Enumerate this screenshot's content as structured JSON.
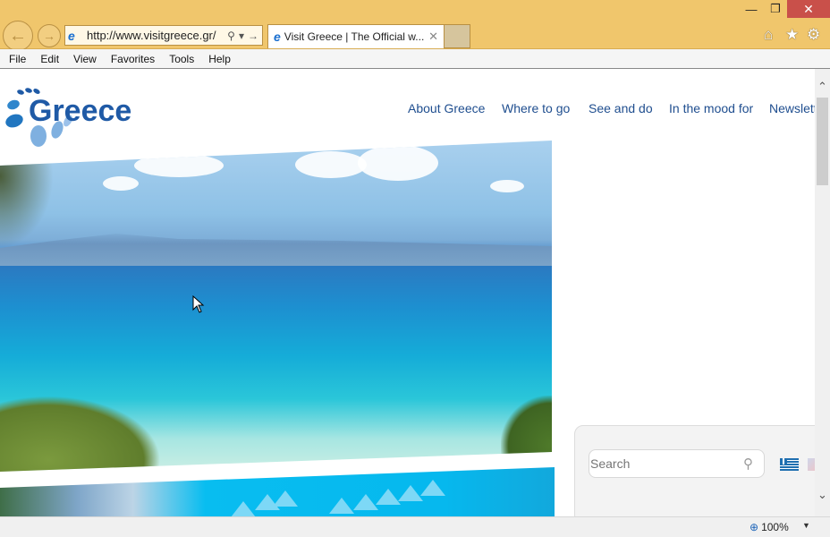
{
  "browser": {
    "address_url": "http://www.visitgreece.gr/",
    "tab_title": "Visit Greece | The Official w...",
    "window_controls": {
      "minimize": "—",
      "restore": "❐",
      "close": "✕"
    },
    "toolbar_icons": [
      "home-icon",
      "favorites-star-icon",
      "settings-gear-icon"
    ],
    "menu": [
      "File",
      "Edit",
      "View",
      "Favorites",
      "Tools",
      "Help"
    ],
    "zoom_level": "100%"
  },
  "site": {
    "logo_text": "Greece",
    "nav": [
      "About Greece",
      "Where to go",
      "See and do",
      "In the mood for",
      "Newslett"
    ],
    "search_placeholder": "Search",
    "languages": [
      "greek-flag",
      "uk-flag"
    ]
  },
  "colors": {
    "chrome_bg": "#f0c66c",
    "close_red": "#c9504a",
    "nav_blue": "#1f4e8f",
    "logo_blue": "#1f5aa6",
    "band_cyan": "#06b8ee"
  }
}
